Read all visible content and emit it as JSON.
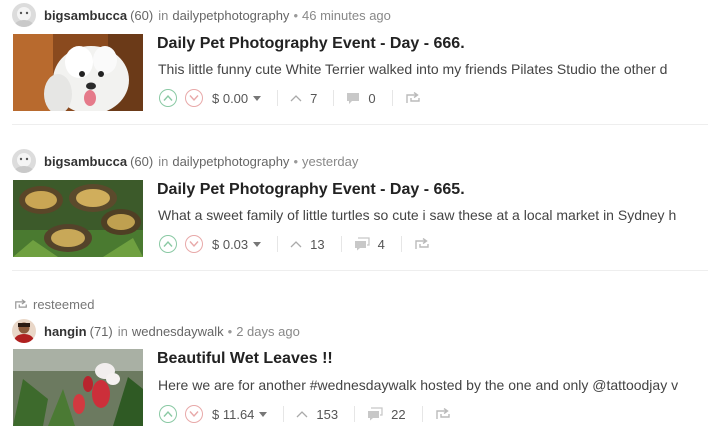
{
  "posts": [
    {
      "author": "bigsambucca",
      "reputation": "(60)",
      "in_word": "in",
      "community": "dailypetphotography",
      "separator": "•",
      "time": "46 minutes ago",
      "title": "Daily Pet Photography Event - Day - 666.",
      "excerpt": "This little funny cute White Terrier walked into my friends Pilates Studio the other d",
      "payout": "$ 0.00",
      "votes": "7",
      "comments": "0"
    },
    {
      "author": "bigsambucca",
      "reputation": "(60)",
      "in_word": "in",
      "community": "dailypetphotography",
      "separator": "•",
      "time": "yesterday",
      "title": "Daily Pet Photography Event - Day - 665.",
      "excerpt": "What a sweet family of little turtles so cute i saw these at a local market in Sydney h",
      "payout": "$ 0.03",
      "votes": "13",
      "comments": "4"
    },
    {
      "resteemed_label": "resteemed",
      "author": "hangin",
      "reputation": "(71)",
      "in_word": "in",
      "community": "wednesdaywalk",
      "separator": "•",
      "time": "2 days ago",
      "title": "Beautiful Wet Leaves !!",
      "excerpt": "Here we are for another #wednesdaywalk hosted by the one and only @tattoodjay v",
      "payout": "$ 11.64",
      "votes": "153",
      "comments": "22"
    }
  ],
  "colors": {
    "upvote": "#8ac9a4",
    "downvote": "#e8a9a9",
    "divider": "#eeeeee"
  },
  "icons": [
    "upvote-icon",
    "downvote-icon",
    "caret-down-icon",
    "vote-count-icon",
    "comment-icon",
    "resteem-icon"
  ]
}
